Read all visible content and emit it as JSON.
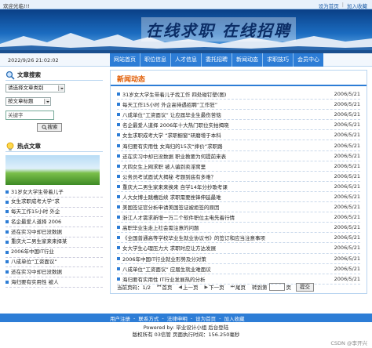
{
  "topbar": {
    "welcome": "欢迎光临!!!",
    "set_home": "设为首页",
    "favorite": "加入收藏"
  },
  "banner": {
    "slogan": "在线求职 在线招聘"
  },
  "datebar": {
    "datetime": "2022/9/26 21:02:02"
  },
  "nav": [
    "网站首页",
    "职位信息",
    "人才信息",
    "委托招聘",
    "新闻动态",
    "求职技巧",
    "会员中心"
  ],
  "sidebar": {
    "search_title": "文章搜索",
    "category_select": "请选择文章类别",
    "field_select": "按文章标题",
    "keyword_value": "关键字",
    "search_button": "搜索",
    "hot_title": "热点文章",
    "hot_items": [
      "31岁女大学生带着儿子",
      "女生求职成考大学“求",
      "每天工作15小时 外企",
      "名企最爱人道择 2006",
      "还在实习中却已没数据",
      "重庆大二男生家来来择某",
      "2006年中国IT行业",
      "八成单位“工资面议”",
      "还在实习中却已没数据",
      "海归要有实用性 被人"
    ]
  },
  "main": {
    "tab": "新闻动态",
    "news": [
      {
        "title": "31岁女大学生带着儿子找工作 四处碰钉壁(图)",
        "date": "2006/5/21"
      },
      {
        "title": "每天工作15小时 外企高待遇招聘“工作狂”",
        "date": "2006/5/21"
      },
      {
        "title": "八成单位“工资面议” 让应届毕业生最伤苦恼",
        "date": "2006/5/21"
      },
      {
        "title": "名企最爱人道择 2006年十大热门职位实拍揭晓",
        "date": "2006/5/21"
      },
      {
        "title": "女生求职成考大学 “求职橱窗”研磨增于本科",
        "date": "2006/5/21"
      },
      {
        "title": "海归要有实用性 女海归的15次“摔价”求职路",
        "date": "2006/5/21"
      },
      {
        "title": "还在实习中却已没数据 职业教要为何提前来表",
        "date": "2006/5/21"
      },
      {
        "title": "大四女生上网求职 被人骗到卖淫窝里",
        "date": "2006/5/21"
      },
      {
        "title": "公务员考试面试大揭秘 考题到底有多难？",
        "date": "2006/5/21"
      },
      {
        "title": "重庆大二男生家来来换来 自学14年分抄歌考课",
        "date": "2006/5/21"
      },
      {
        "title": "人大女博士跳槽后续 求职需要挫锋伸延最难",
        "date": "2006/5/21"
      },
      {
        "title": "美国签证官分析申请美国签证被拒签的原因",
        "date": "2006/5/21"
      },
      {
        "title": "浙江人才需求新增一万二个软件职位主电先着行情",
        "date": "2006/5/21"
      },
      {
        "title": "高职毕业生走上社会需注意的问题",
        "date": "2006/5/21"
      },
      {
        "title": "《全国普通高等学校毕业生就业协议书》的签订和应当注意事项",
        "date": "2006/5/21"
      },
      {
        "title": "女大学生心理压力大 求职时应让方达发展",
        "date": "2006/5/21"
      },
      {
        "title": "2006年中国IT行业就业形势及分对策",
        "date": "2006/5/21"
      },
      {
        "title": "八成单位“工资面议” 应届生就业难面议",
        "date": "2006/5/21"
      },
      {
        "title": "海归要有实用性 IT行业发展热的分析",
        "date": "2006/5/21"
      }
    ],
    "pager": {
      "current": "当前页码：1/2",
      "first": "首页",
      "prev": "上一页",
      "next": "下一页",
      "last": "尾页",
      "goto": "转到第",
      "page_unit": "页",
      "submit": "提交"
    }
  },
  "footnav": [
    "用户注册",
    "联系方式",
    "法律申明",
    "设为首页",
    "加入收藏"
  ],
  "footer": {
    "line1": "Powered by: 毕业设计小组  后台登陆",
    "line2": "版权所有 03信管  页面执行时间：156.250毫秒"
  },
  "watermark": "CSDN @李开兴"
}
